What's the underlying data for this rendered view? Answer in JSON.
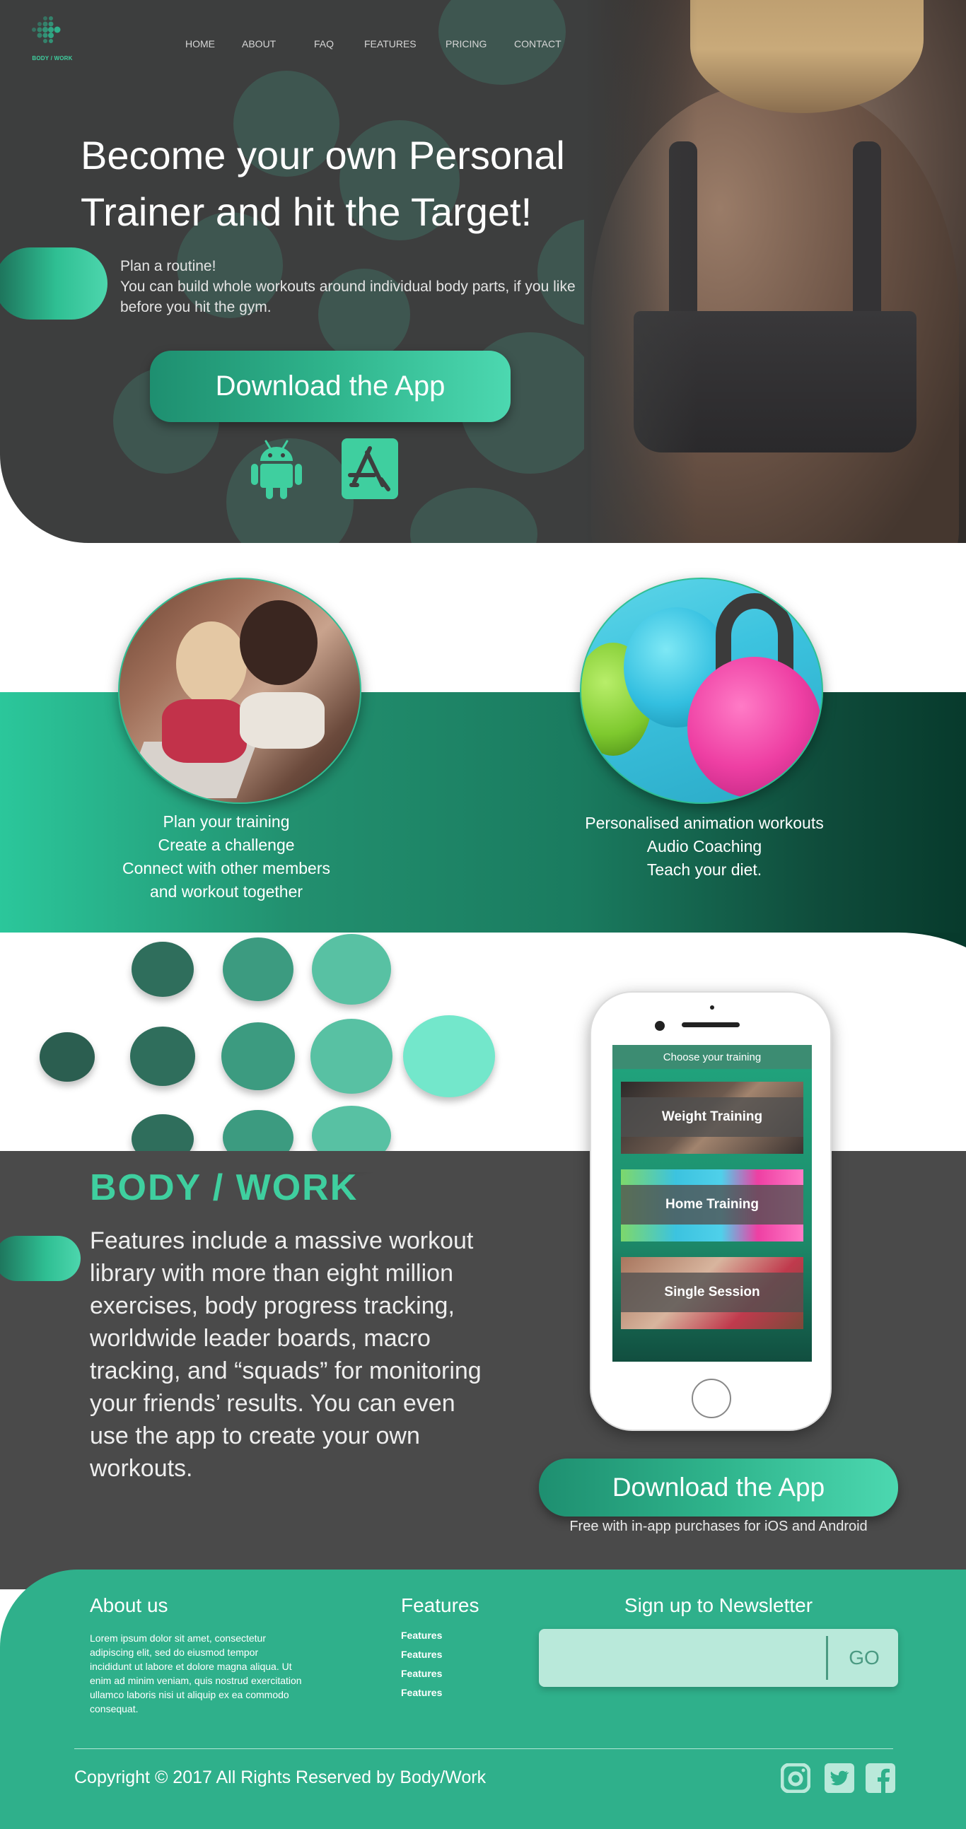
{
  "brand": {
    "logo_text": "BODY / WORK",
    "accent": "#2fb08b",
    "accent_light": "#4dd6ad",
    "dark_bg": "#3d3e3e"
  },
  "nav": {
    "items": [
      {
        "label": "HOME"
      },
      {
        "label": "ABOUT"
      },
      {
        "label": "FAQ"
      },
      {
        "label": "FEATURES"
      },
      {
        "label": "PRICING"
      },
      {
        "label": "CONTACT"
      }
    ]
  },
  "hero": {
    "title_line1": "Become your own Personal",
    "title_line2": "Trainer and hit the Target!",
    "sub_line1": "Plan a routine!",
    "sub_line2": "You can build whole workouts around individual body parts, if you like",
    "sub_line3": "before you hit the gym.",
    "download_label": "Download the App",
    "android_icon": "android-icon",
    "appstore_icon": "app-store-icon"
  },
  "features_band": {
    "left_lines": [
      "Plan your training",
      "Create a challenge",
      "Connect with other members",
      "and workout together"
    ],
    "right_lines": [
      "Personalised animation workouts",
      "Audio Coaching",
      "Teach your diet."
    ]
  },
  "product": {
    "brand_title": "BODY / WORK",
    "description_lines": [
      "Features include a massive workout",
      "library with more than eight million",
      "exercises, body progress tracking,",
      "worldwide leader boards, macro",
      "tracking, and “squads” for monitoring",
      "your friends’ results. You can even",
      "use the app to create your own",
      "workouts."
    ],
    "phone": {
      "header": "Choose your training",
      "cards": [
        "Weight Training",
        "Home Training",
        "Single Session"
      ]
    },
    "download_label": "Download the App",
    "download_sub": "Free with in-app purchases for iOS and Android"
  },
  "footer": {
    "about_title": "About us",
    "about_lines": [
      "Lorem ipsum dolor sit amet, consectetur",
      "adipiscing elit, sed do eiusmod tempor",
      "incididunt ut labore et dolore magna aliqua. Ut",
      "enim ad minim veniam, quis nostrud exercitation",
      "ullamco laboris nisi ut aliquip ex ea commodo",
      "consequat."
    ],
    "features_title": "Features",
    "features_links": [
      "Features",
      "Features",
      "Features",
      "Features"
    ],
    "newsletter_title": "Sign up to Newsletter",
    "newsletter_placeholder": "",
    "newsletter_button": "GO",
    "copyright": "Copyright © 2017 All Rights Reserved by Body/Work",
    "social_icons": [
      "instagram-icon",
      "twitter-icon",
      "facebook-icon"
    ]
  }
}
